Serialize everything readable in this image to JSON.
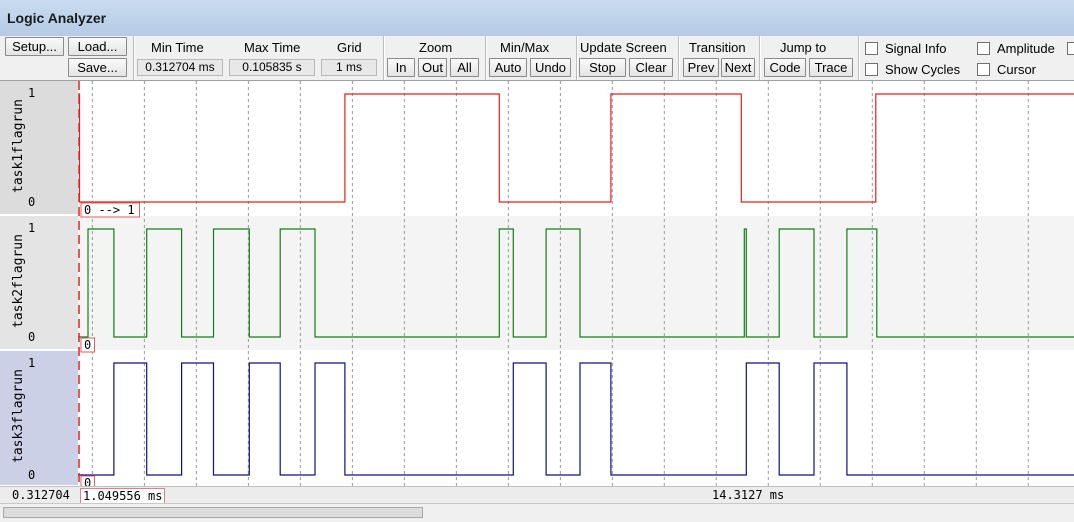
{
  "window": {
    "title": "Logic Analyzer"
  },
  "toolbar": {
    "setup": "Setup...",
    "load": "Load...",
    "save": "Save...",
    "min_time_label": "Min Time",
    "min_time_value": "0.312704 ms",
    "max_time_label": "Max Time",
    "max_time_value": "0.105835 s",
    "grid_label": "Grid",
    "grid_value": "1 ms",
    "zoom_label": "Zoom",
    "zoom_in": "In",
    "zoom_out": "Out",
    "zoom_all": "All",
    "minmax_label": "Min/Max",
    "auto": "Auto",
    "undo": "Undo",
    "update_label": "Update Screen",
    "stop": "Stop",
    "clear": "Clear",
    "transition_label": "Transition",
    "prev": "Prev",
    "next": "Next",
    "jump_label": "Jump to",
    "code": "Code",
    "trace": "Trace",
    "signal_info": "Signal Info",
    "show_cycles": "Show Cycles",
    "amplitude": "Amplitude",
    "cursor": "Cursor"
  },
  "signals": [
    {
      "name": "task1flagrun",
      "color": "#e02020",
      "bg": "#ffffff",
      "label_bg": "#dcdcdc",
      "high": "1",
      "low": "0",
      "edges": [
        [
          0,
          1
        ],
        [
          1.5,
          0
        ],
        [
          268,
          1
        ],
        [
          423,
          0
        ],
        [
          535,
          1
        ],
        [
          666,
          0
        ],
        [
          801,
          1
        ],
        [
          1000,
          1
        ]
      ],
      "annotation": "0 --> 1"
    },
    {
      "name": "task2flagrun",
      "color": "#108010",
      "bg": "#f4f4f4",
      "label_bg": "#e4e4e4",
      "high": "1",
      "low": "0",
      "edges": [
        [
          0,
          0
        ],
        [
          10,
          1
        ],
        [
          36,
          0
        ],
        [
          69,
          1
        ],
        [
          104,
          0
        ],
        [
          136,
          1
        ],
        [
          172,
          0
        ],
        [
          203,
          1
        ],
        [
          238,
          0
        ],
        [
          423,
          1
        ],
        [
          437,
          0
        ],
        [
          470,
          1
        ],
        [
          504,
          0
        ],
        [
          669,
          1
        ],
        [
          671,
          0
        ],
        [
          704,
          1
        ],
        [
          739,
          0
        ],
        [
          772,
          1
        ],
        [
          802,
          0
        ],
        [
          1000,
          0
        ]
      ],
      "annotation": "0"
    },
    {
      "name": "task3flagrun",
      "color": "#101080",
      "bg": "#ffffff",
      "label_bg": "#ccd0e6",
      "high": "1",
      "low": "0",
      "edges": [
        [
          0,
          0
        ],
        [
          36,
          1
        ],
        [
          69,
          0
        ],
        [
          104,
          1
        ],
        [
          136,
          0
        ],
        [
          172,
          1
        ],
        [
          203,
          0
        ],
        [
          238,
          1
        ],
        [
          268,
          0
        ],
        [
          437,
          1
        ],
        [
          470,
          0
        ],
        [
          504,
          1
        ],
        [
          535,
          0
        ],
        [
          671,
          1
        ],
        [
          704,
          0
        ],
        [
          739,
          1
        ],
        [
          772,
          0
        ],
        [
          1000,
          0
        ]
      ],
      "annotation": "0"
    }
  ],
  "timeline": {
    "cursor_x": 0,
    "grid_x": [
      14.5,
      66.7,
      118.9,
      171.1,
      223.3,
      275.5,
      327.7,
      379.9,
      432.1,
      484.3,
      536.5,
      588.7,
      640.9,
      693.1,
      745.3,
      797.5,
      849.7,
      901.9,
      954.1,
      1006.3
    ]
  },
  "status": {
    "left_time": "0.312704",
    "cursor_time": "1.049556 ms",
    "center_time": "14.3127 ms"
  }
}
